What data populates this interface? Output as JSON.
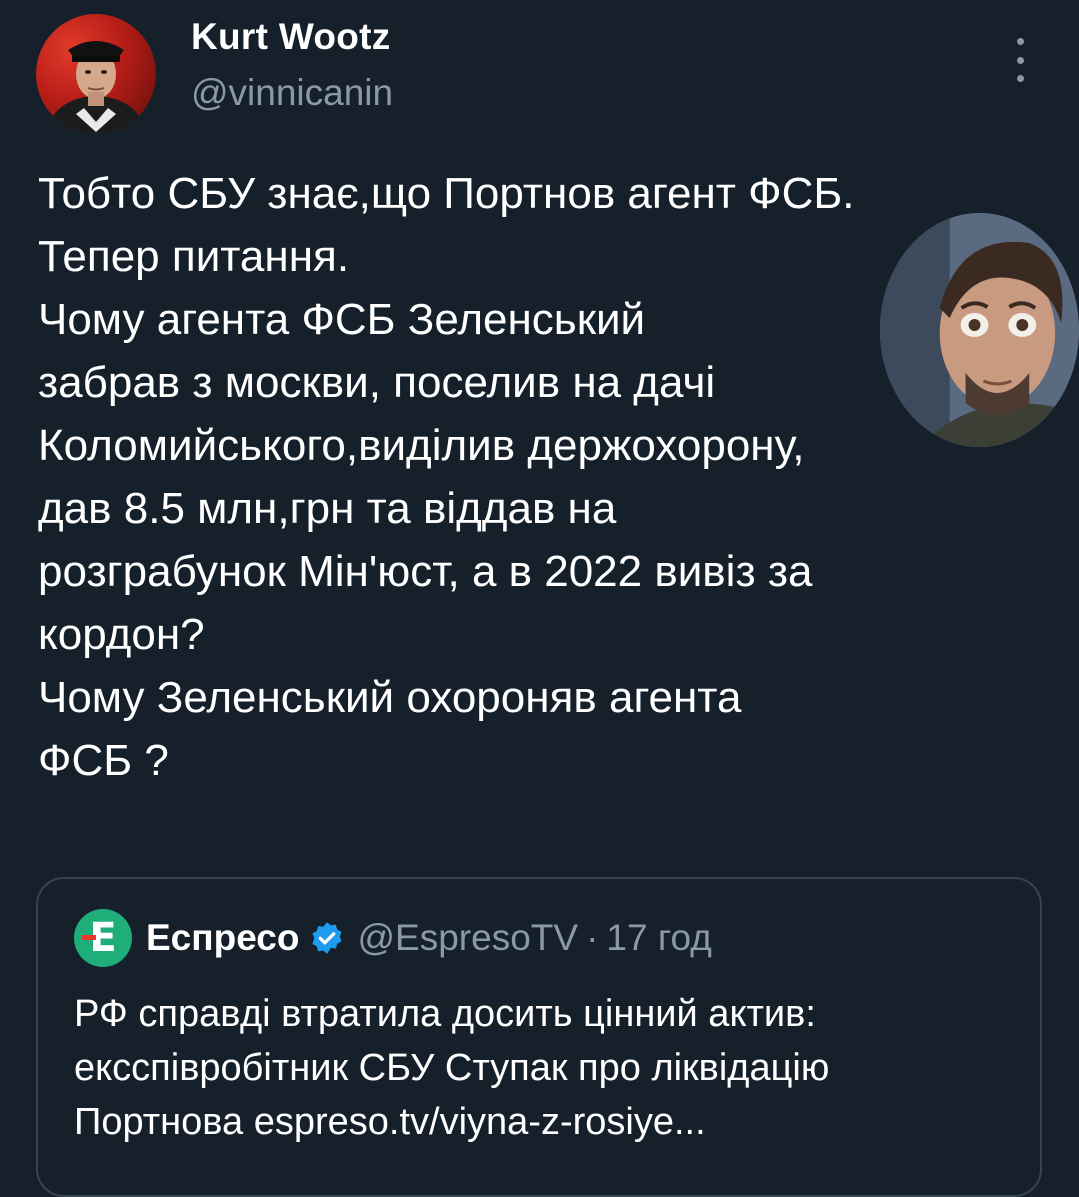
{
  "author": {
    "display_name": "Kurt Wootz",
    "handle": "@vinnicanin"
  },
  "menu": {
    "icon": "more-vertical-icon"
  },
  "tweet": {
    "lines": [
      "Тобто СБУ знає,що Портнов агент ФСБ.",
      "Тепер питання.",
      "Чому агента ФСБ Зеленський",
      "забрав з москви, поселив на дачі",
      "Коломийського,виділив держохорону,",
      "дав 8.5 млн,грн та віддав на",
      "розграбунок Мін'юст, а в 2022 вивіз за",
      "кордон?",
      "Чому Зеленський охороняв агента",
      "ФСБ ?"
    ]
  },
  "quote": {
    "name": "Еспресо",
    "handle": "@EspresoTV",
    "separator": "·",
    "time": "17 год",
    "logo_letter": "Е",
    "verified_icon": "verified-badge-icon",
    "lines": [
      "РФ справді втратила досить цінний актив:",
      "ексспівробітник СБУ Ступак про ліквідацію",
      "Портнова espreso.tv/viyna-z-rosiye..."
    ]
  },
  "colors": {
    "background": "#15202b",
    "secondary_text": "#8b98a5",
    "border": "#38444d",
    "verified_blue": "#1d9bf0",
    "espreso_green": "#1fae7a"
  }
}
